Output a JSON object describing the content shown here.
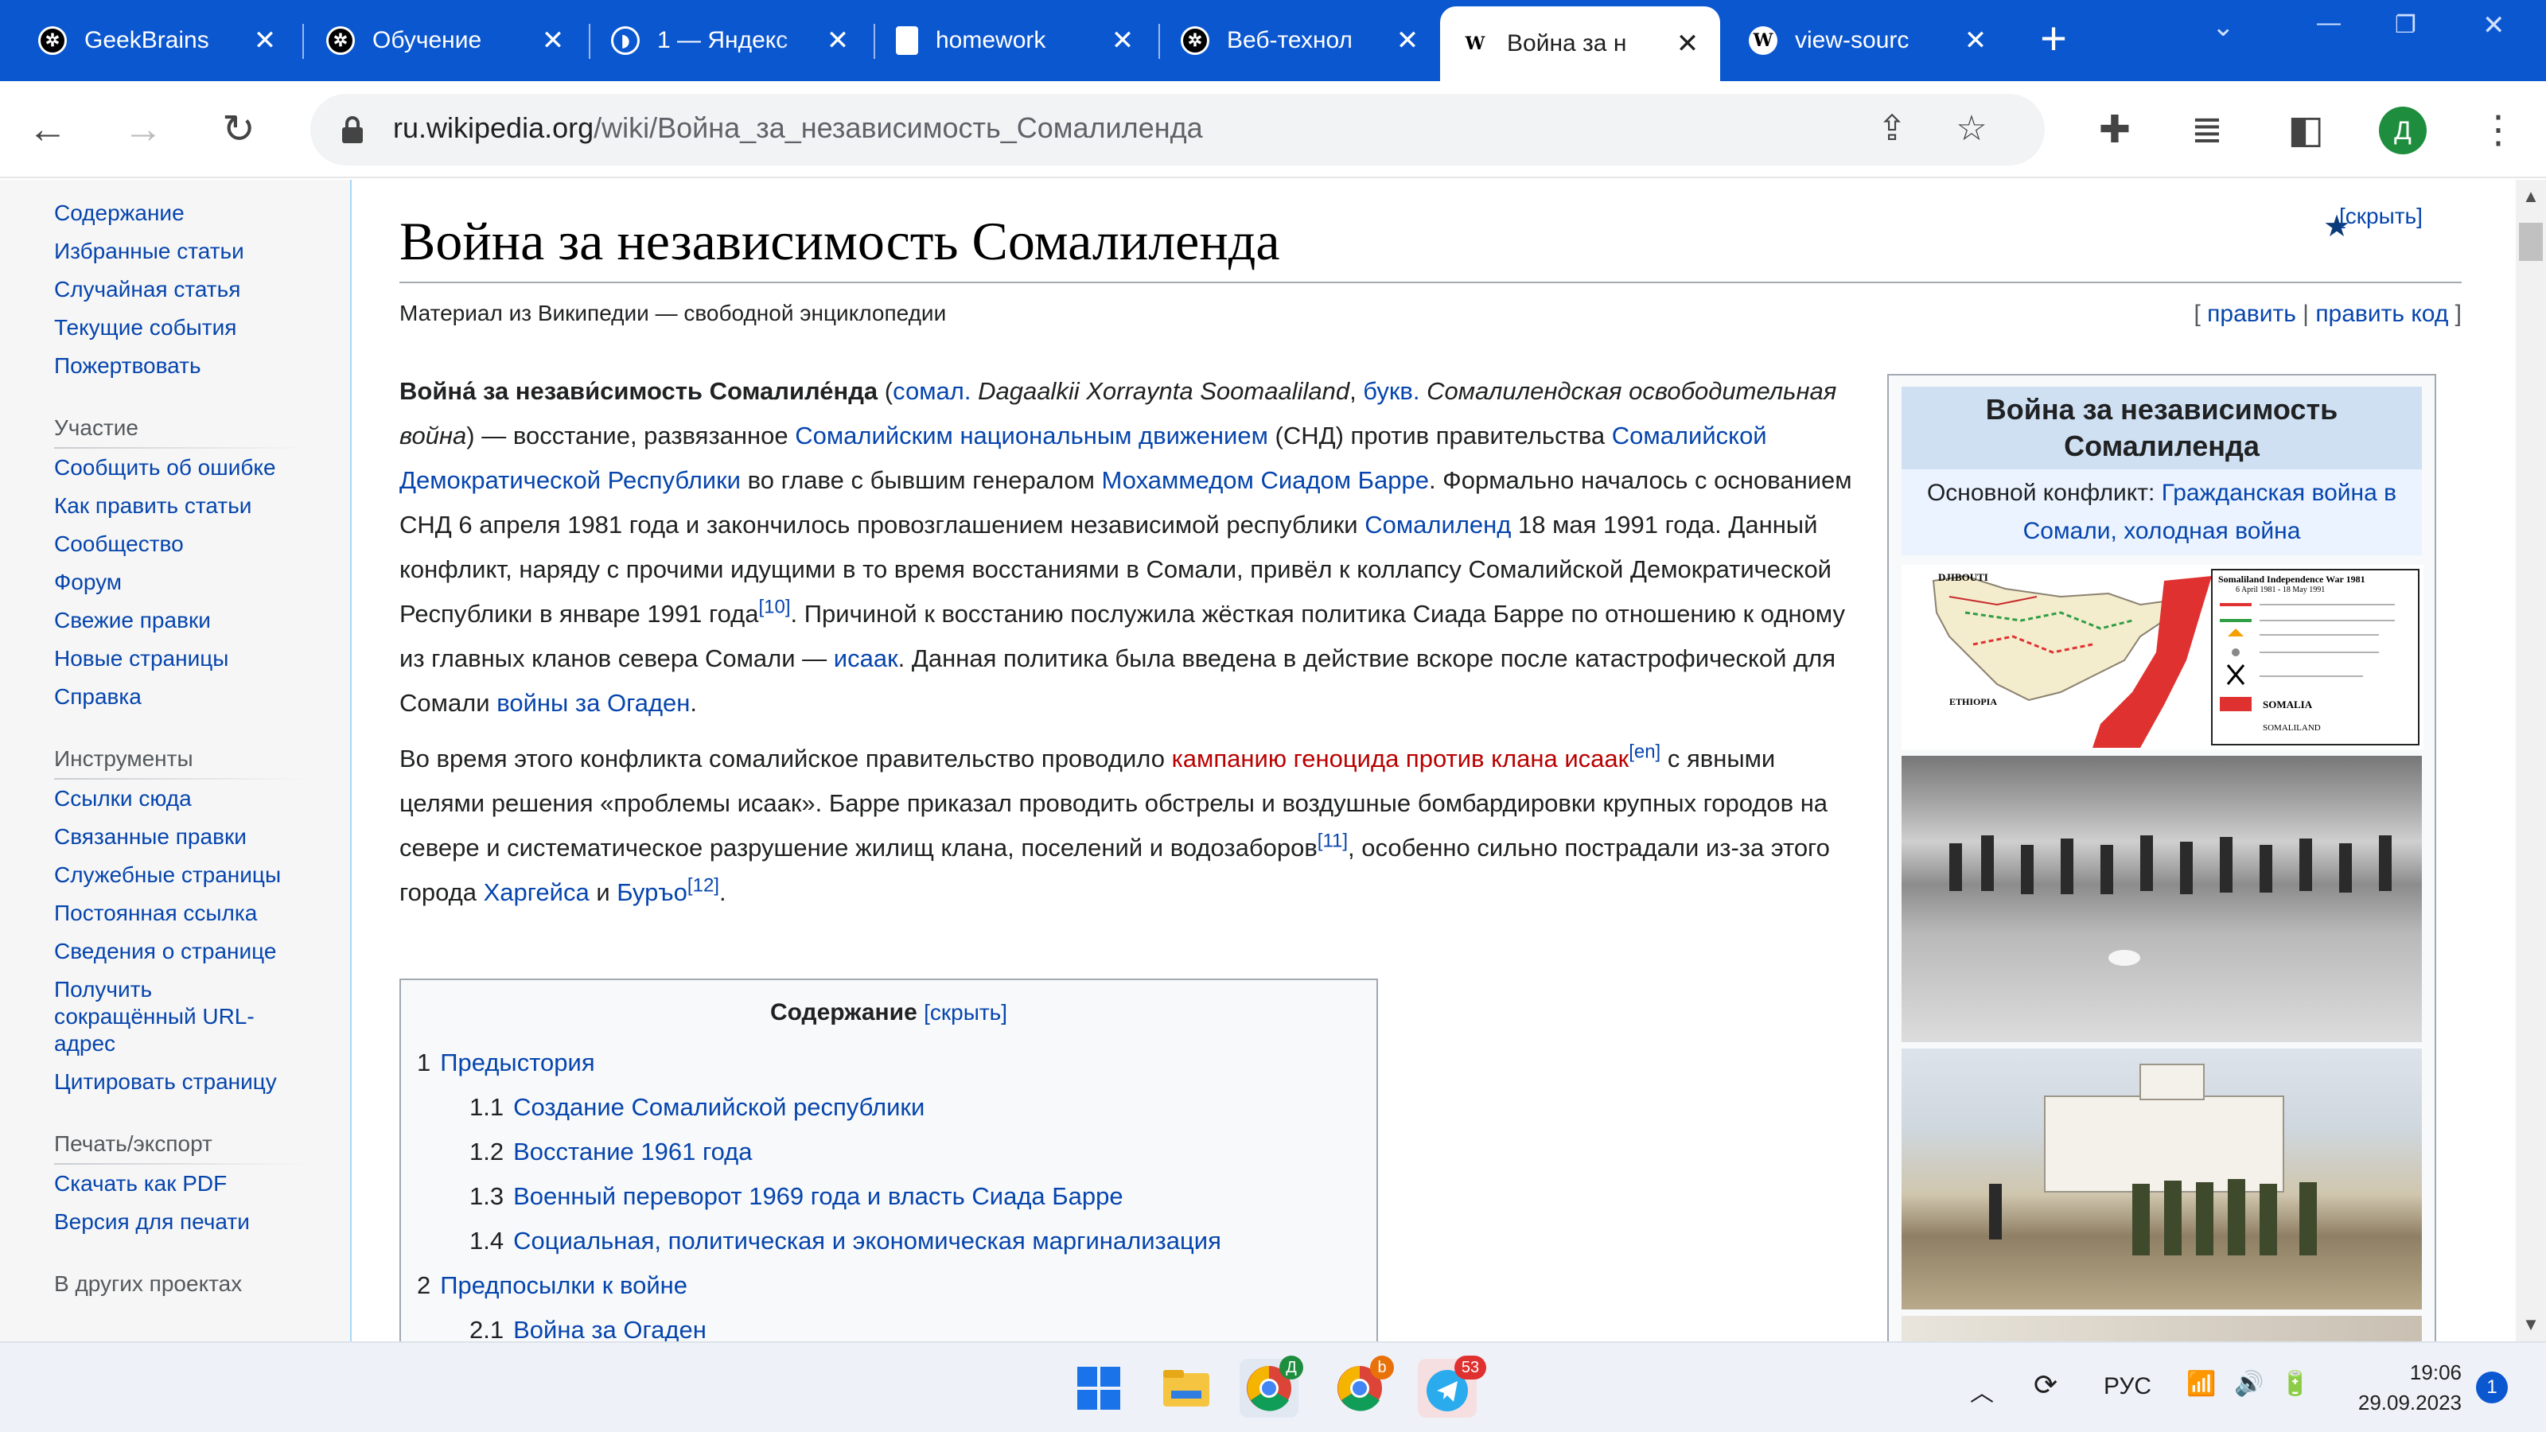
{
  "browser": {
    "tabs": [
      {
        "title": "GeekBrains",
        "icon": "openai-icon"
      },
      {
        "title": "Обучение",
        "icon": "openai-icon"
      },
      {
        "title": "1 — Яндекс",
        "icon": "yandex-icon"
      },
      {
        "title": "homework",
        "icon": "document-icon"
      },
      {
        "title": "Веб-технол",
        "icon": "openai-icon"
      },
      {
        "title": "Война за н",
        "icon": "wikipedia-icon",
        "active": true
      },
      {
        "title": "view-sourc",
        "icon": "wikipedia-icon"
      }
    ],
    "url_host": "ru.wikipedia.org",
    "url_path": "/wiki/Война_за_независимость_Сомалиленда",
    "avatar_letter": "Д",
    "wiki_favicon": "W"
  },
  "sidebar": {
    "nav_items": [
      "Содержание",
      "Избранные статьи",
      "Случайная статья",
      "Текущие события",
      "Пожертвовать"
    ],
    "participation_heading": "Участие",
    "participation_items": [
      "Сообщить об ошибке",
      "Как править статьи",
      "Сообщество",
      "Форум",
      "Свежие правки",
      "Новые страницы",
      "Справка"
    ],
    "tools_heading": "Инструменты",
    "tools_items": [
      "Ссылки сюда",
      "Связанные правки",
      "Служебные страницы",
      "Постоянная ссылка",
      "Сведения о странице",
      "Получить сокращённый URL-адрес",
      "Цитировать страницу"
    ],
    "print_heading": "Печать/экспорт",
    "print_items": [
      "Скачать как PDF",
      "Версия для печати"
    ],
    "other_heading": "В других проектах"
  },
  "article": {
    "title": "Война за независимость Сомалиленда",
    "hide_label": "[скрыть]",
    "tagline": "Материал из Википедии — свободной энциклопедии",
    "edit": "править",
    "edit_code": "править код",
    "p1": {
      "bold": "Война́ за незави́симость Сомалиле́нда",
      "somali_abbr": "сомал.",
      "somali_name": "Dagaalkii Xorraynta Soomaaliland",
      "lit_abbr": "букв.",
      "lit_name": "Сомалилендская освободительная война",
      "t1": ") — восстание, развязанное ",
      "l_snm": "Сомалийским национальным движением",
      "t2": " (СНД) против правительства ",
      "l_sdr": "Сомалийской Демократической Республики",
      "t3": " во главе с бывшим генералом ",
      "l_barre": "Мохаммедом Сиадом Барре",
      "t4": ". Формально началось с основанием СНД 6 апреля 1981 года и закончилось провозглашением независимой республики ",
      "l_somaliland": "Сомалиленд",
      "t5": " 18 мая 1991 года. Данный конфликт, наряду с прочими идущими в то время восстаниями в Сомали, привёл к коллапсу Сомалийской Демократической Республики в январе 1991 года",
      "ref10": "[10]",
      "t6": ". Причиной к восстанию послужила жёсткая политика Сиада Барре по отношению к одному из главных кланов севера Сомали — ",
      "l_isaaq": "исаак",
      "t7": ". Данная политика была введена в действие вскоре после катастрофической для Сомали ",
      "l_ogaden": "войны за Огаден",
      "t8": "."
    },
    "p2": {
      "t1": "Во время этого конфликта сомалийское правительство проводило ",
      "l_genocide": "кампанию геноцида против клана исаак",
      "ref_en": "[en]",
      "t2": " с явными целями решения «проблемы исаак». Барре приказал проводить обстрелы и воздушные бомбардировки крупных городов на севере и систематическое разрушение жилищ клана, поселений и водозаборов",
      "ref11": "[11]",
      "t3": ", особенно сильно пострадали из-за этого города ",
      "l_hargeisa": "Харгейса",
      "t4": " и ",
      "l_burao": "Буръо",
      "ref12": "[12]",
      "t5": "."
    }
  },
  "toc": {
    "title": "Содержание",
    "hide": "[скрыть]",
    "items": [
      {
        "num": "1",
        "text": "Предыстория",
        "level": 1
      },
      {
        "num": "1.1",
        "text": "Создание Сомалийской республики",
        "level": 2
      },
      {
        "num": "1.2",
        "text": "Восстание 1961 года",
        "level": 2
      },
      {
        "num": "1.3",
        "text": "Военный переворот 1969 года и власть Сиада Барре",
        "level": 2
      },
      {
        "num": "1.4",
        "text": "Социальная, политическая и экономическая маргинализация",
        "level": 2
      },
      {
        "num": "2",
        "text": "Предпосылки к войне",
        "level": 1
      },
      {
        "num": "2.1",
        "text": "Война за Огаден",
        "level": 2
      }
    ]
  },
  "infobox": {
    "title": "Война за независимость Сомалиленда",
    "conflict_label": "Основной конфликт: ",
    "conflict_link": "Гражданская война в Сомали, холодная война",
    "map": {
      "djibouti": "DJIBOUTI",
      "ethiopia": "ETHIOPIA",
      "legend_title": "Somaliland Independence War 1981",
      "legend_dates": "6 April 1981 - 18 May 1991",
      "somalia": "SOMALIA",
      "somaliland": "SOMALILAND"
    }
  },
  "taskbar": {
    "language": "РУС",
    "time": "19:06",
    "date": "29.09.2023",
    "notification_count": "1",
    "telegram_badge": "53",
    "chrome_profile_1": "Д",
    "chrome_profile_2": "b"
  }
}
